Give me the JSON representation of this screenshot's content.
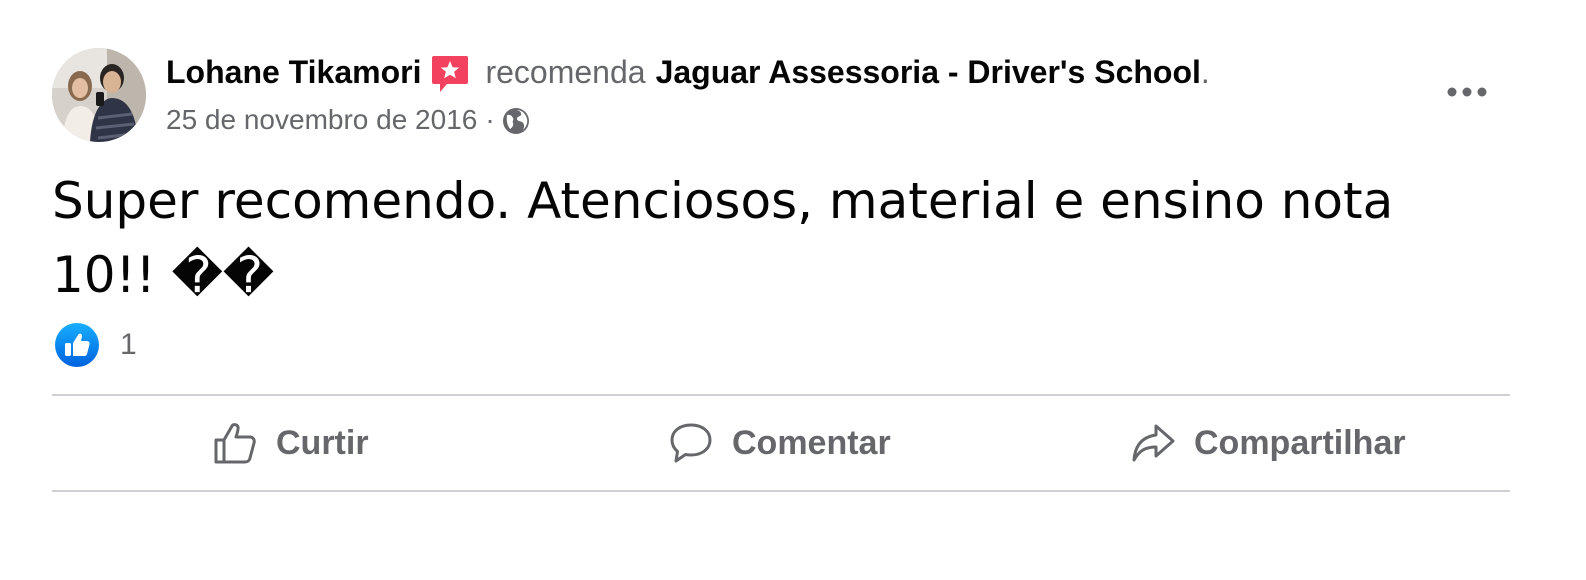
{
  "post": {
    "author": "Lohane Tikamori",
    "action_verb": "recomenda",
    "page_name": "Jaguar Assessoria - Driver's School",
    "period": ".",
    "date": "25 de novembro de 2016",
    "separator": "·",
    "privacy_icon": "globe-icon",
    "recommend_badge_icon": "recommendation-star-icon",
    "text": "Super recomendo. Atenciosos, material e ensino nota 10!! ��",
    "reaction_icon": "like-emoji-icon",
    "reaction_count": "1"
  },
  "actions": {
    "like_label": "Curtir",
    "comment_label": "Comentar",
    "share_label": "Compartilhar"
  },
  "colors": {
    "primary_text": "#050505",
    "secondary_text": "#65676b",
    "divider": "#ced0d4",
    "like_blue": "#1877f2",
    "badge_pink": "#f3425f"
  }
}
